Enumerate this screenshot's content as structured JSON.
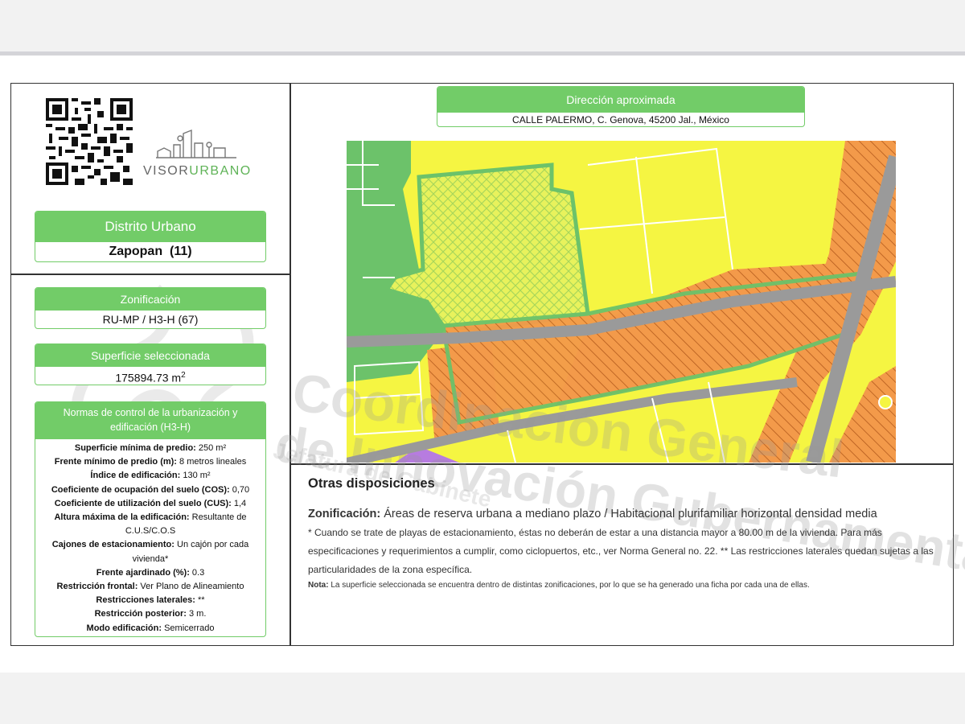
{
  "brand": {
    "name_a": "VISOR",
    "name_b": "URBANO"
  },
  "distrito": {
    "label": "Distrito Urbano",
    "value": "Zapopan  (11)"
  },
  "zonificacion": {
    "label": "Zonificación",
    "value": "RU-MP / H3-H (67)"
  },
  "superficie": {
    "label": "Superficie seleccionada",
    "value": "175894.73 m",
    "unit_sup": "2"
  },
  "normas": {
    "title": "Normas de control de la urbanización y edificación (H3-H)",
    "items": [
      {
        "k": "Superficie mínima de predio:",
        "v": " 250 m²"
      },
      {
        "k": "Frente mínimo de predio (m):",
        "v": " 8 metros lineales"
      },
      {
        "k": "Índice de edificación:",
        "v": " 130 m²"
      },
      {
        "k": "Coeficiente de ocupación del suelo (COS):",
        "v": " 0,70"
      },
      {
        "k": "Coeficiente de utilización del suelo (CUS):",
        "v": " 1,4"
      },
      {
        "k": "Altura máxima de la edificación:",
        "v": " Resultante de C.U.S/C.O.S"
      },
      {
        "k": "Cajones de estacionamiento:",
        "v": " Un cajón por cada vivienda*"
      },
      {
        "k": "Frente ajardinado (%):",
        "v": " 0.3"
      },
      {
        "k": "Restricción frontal:",
        "v": " Ver Plano de Alineamiento"
      },
      {
        "k": "Restricciones laterales:",
        "v": " **"
      },
      {
        "k": "Restricción posterior:",
        "v": " 3 m."
      },
      {
        "k": "Modo edificación:",
        "v": " Semicerrado"
      }
    ]
  },
  "direccion": {
    "label": "Dirección aproximada",
    "value": "CALLE PALERMO, C. Genova, 45200 Jal., México"
  },
  "otras": {
    "title": "Otras disposiciones",
    "zon_label": "Zonificación:",
    "zon_value": " Áreas de reserva urbana a mediano plazo / Habitacional plurifamiliar horizontal densidad media",
    "note": "* Cuando se trate de playas de estacionamiento, éstas no deberán de estar a una distancia mayor a 80.00 m de la vivienda. Para más especificaciones y requerimientos a cumplir, como ciclopuertos, etc., ver Norma General no. 22. ** Las restricciones laterales quedan sujetas a las particularidades de la zona específica.",
    "nota_label": "Nota:",
    "nota_value": " La superficie seleccionada se encuentra dentro de distintas zonificaciones, por lo que se ha generado una ficha por cada una de ellas."
  },
  "watermark": {
    "line1": "Coordinación General",
    "line2": "de Innovación Gubernamental",
    "line3": "Jefatura de Gabinete"
  },
  "colors": {
    "accent": "#72cc68",
    "yellow": "#f5f542",
    "orange": "#f39a4a",
    "road": "#9a9a9a",
    "green": "#6cc26a",
    "purple": "#b77ce0"
  }
}
